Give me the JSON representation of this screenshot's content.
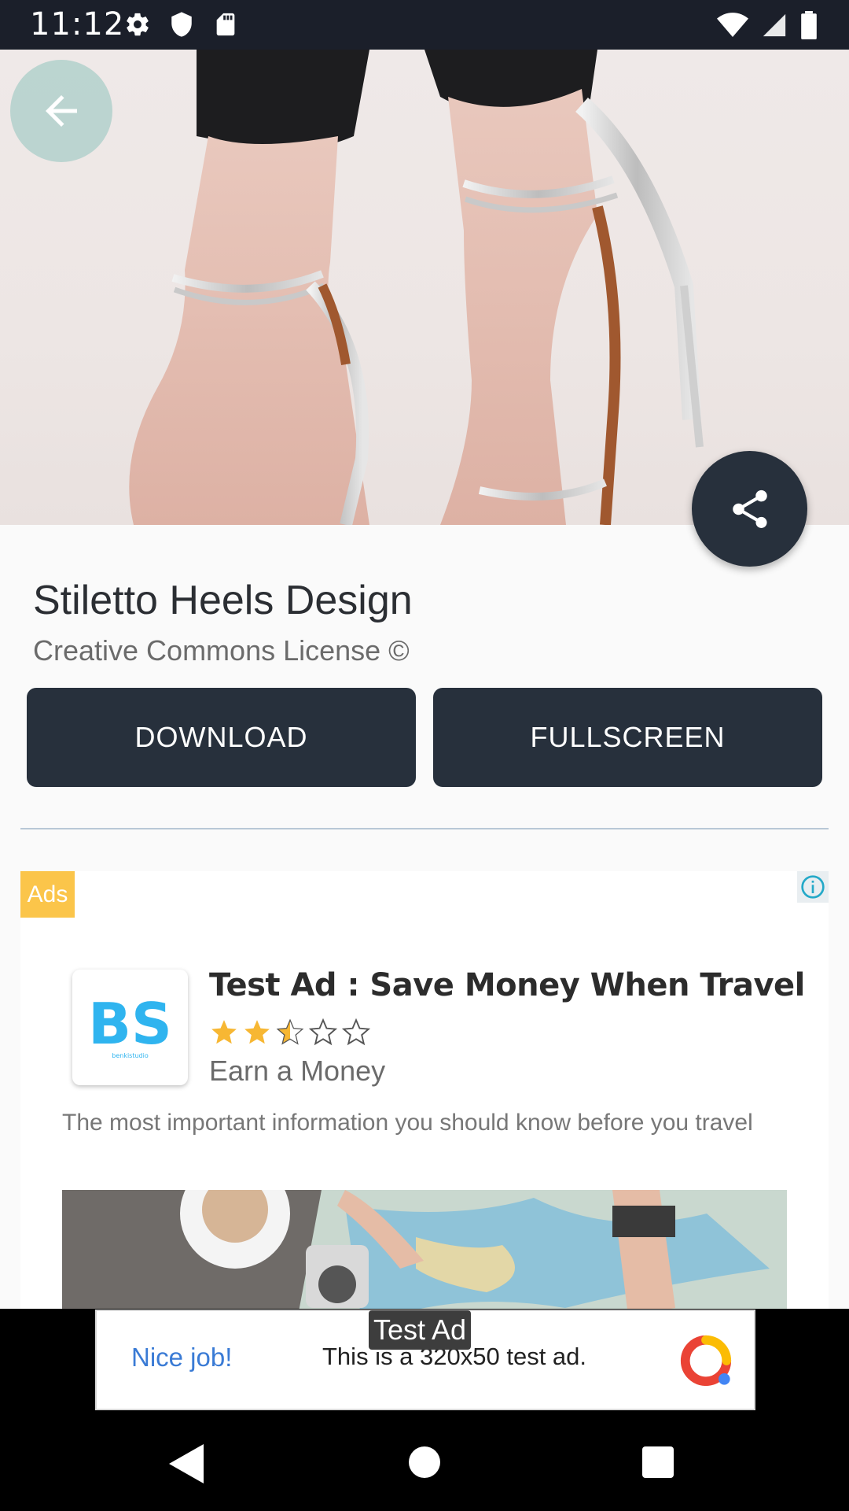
{
  "status_bar": {
    "time": "11:12",
    "icons_left": [
      "gear-icon",
      "shield-icon",
      "sd-card-icon"
    ],
    "icons_right": [
      "wifi-icon",
      "signal-icon",
      "battery-icon"
    ]
  },
  "hero": {
    "back_icon": "arrow-back-icon",
    "share_icon": "share-icon"
  },
  "details": {
    "title": "Stiletto Heels Design",
    "license": "Creative Commons License ©",
    "download_label": "DOWNLOAD",
    "fullscreen_label": "FULLSCREEN"
  },
  "ad": {
    "badge": "Ads",
    "headline": "Test Ad : Save Money When Travel",
    "rating": 2.5,
    "rating_max": 5,
    "advertiser": "Earn a Money",
    "body": "The most important information you should know before you travel",
    "logo_text": "BS",
    "logo_subtext": "benkistudio",
    "accent_color": "#2fb4ef",
    "star_color": "#f7b733"
  },
  "banner": {
    "nice_job": "Nice job!",
    "text": "This is a 320x50 test ad.",
    "label": "Test Ad"
  },
  "colors": {
    "primary_dark": "#27303c",
    "status_bar": "#1b1f2a",
    "background": "#fafafa"
  }
}
